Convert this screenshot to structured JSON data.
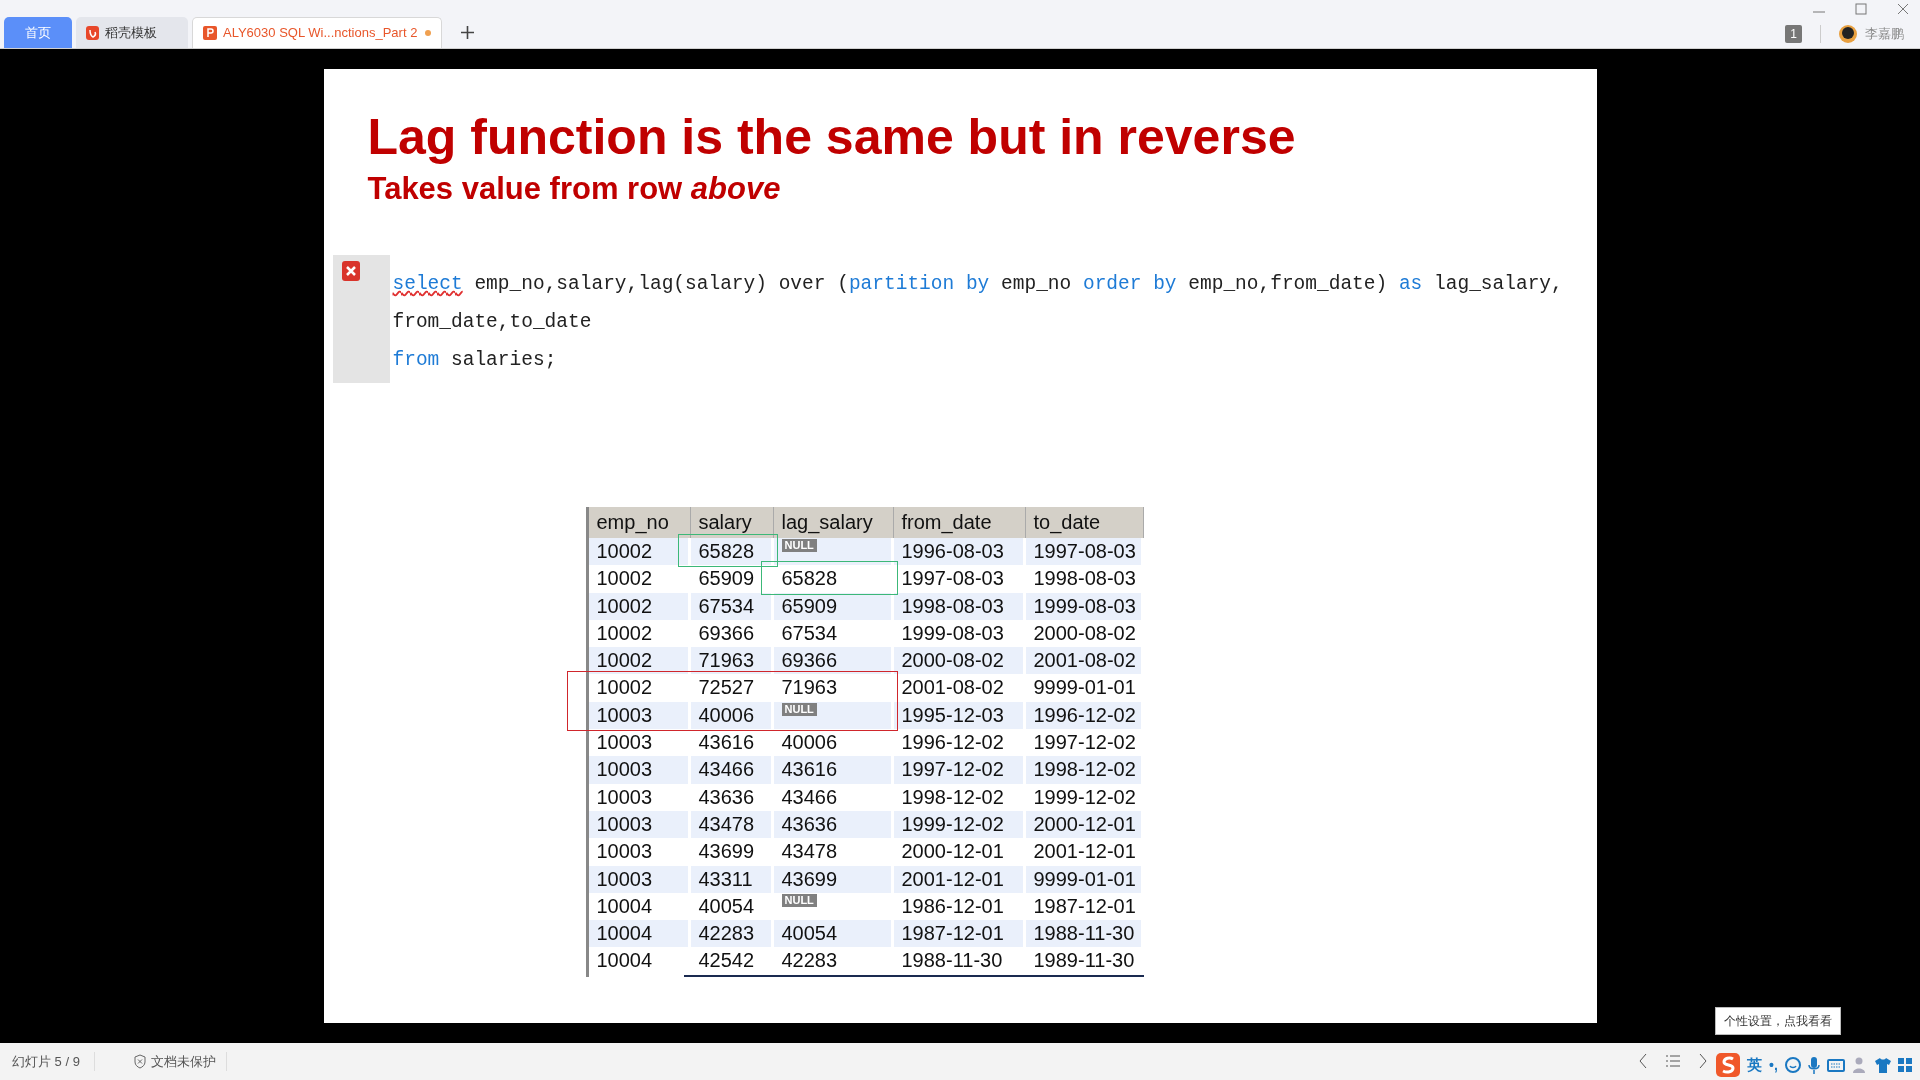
{
  "tabs": [
    {
      "kind": "home",
      "label": "首页",
      "selected": false
    },
    {
      "kind": "templates",
      "label": "稻壳模板",
      "selected": false
    },
    {
      "kind": "document",
      "label": "ALY6030 SQL Wi...nctions_Part 2",
      "selected": true,
      "unsaved": true
    }
  ],
  "account": {
    "badge": "1",
    "user": "李嘉鹏"
  },
  "slide": {
    "title": "Lag function is the same but in reverse",
    "subtitle": "Takes value from row *above*",
    "code": [
      [
        {
          "text": "select",
          "kind": "keyword",
          "error": true
        },
        {
          "text": " emp_no,salary,lag(salary) over (",
          "kind": "plain",
          "error": false
        },
        {
          "text": "partition by",
          "kind": "keyword",
          "error": false
        },
        {
          "text": " emp_no ",
          "kind": "plain",
          "error": false
        },
        {
          "text": "order by",
          "kind": "keyword",
          "error": false
        },
        {
          "text": " emp_no,from_date) ",
          "kind": "plain",
          "error": false
        },
        {
          "text": "as",
          "kind": "keyword",
          "error": false
        },
        {
          "text": " lag_salary,",
          "kind": "plain",
          "error": false
        }
      ],
      [
        {
          "text": "from_date,to_date",
          "kind": "plain",
          "error": false
        }
      ],
      [
        {
          "text": "from",
          "kind": "keyword",
          "error": false
        },
        {
          "text": " salaries;",
          "kind": "plain",
          "error": false
        }
      ]
    ],
    "table": {
      "columns": [
        "emp_no",
        "salary",
        "lag_salary",
        "from_date",
        "to_date"
      ],
      "rows": [
        {
          "cells": [
            "10002",
            "65828",
            "NULL",
            "1996-08-03",
            "1997-08-03"
          ],
          "lag_null": true,
          "cell_frame": {
            "kind": "value",
            "color": "#3cb878"
          }
        },
        {
          "cells": [
            "10002",
            "65909",
            "65828",
            "1997-08-03",
            "1998-08-03"
          ],
          "lag_null": false,
          "cell_frame": {
            "kind": "lag",
            "color": "#3cb878"
          }
        },
        {
          "cells": [
            "10002",
            "67534",
            "65909",
            "1998-08-03",
            "1999-08-03"
          ],
          "lag_null": false
        },
        {
          "cells": [
            "10002",
            "69366",
            "67534",
            "1999-08-03",
            "2000-08-02"
          ],
          "lag_null": false
        },
        {
          "cells": [
            "10002",
            "71963",
            "69366",
            "2000-08-02",
            "2001-08-02"
          ],
          "lag_null": false
        },
        {
          "cells": [
            "10002",
            "72527",
            "71963",
            "2001-08-02",
            "9999-01-01"
          ],
          "lag_null": false,
          "row_frame": {
            "color": "#d0262c"
          }
        },
        {
          "cells": [
            "10003",
            "40006",
            "NULL",
            "1995-12-03",
            "1996-12-02"
          ],
          "lag_null": true,
          "row_frame": {
            "color": "#d0262c"
          }
        },
        {
          "cells": [
            "10003",
            "43616",
            "40006",
            "1996-12-02",
            "1997-12-02"
          ],
          "lag_null": false
        },
        {
          "cells": [
            "10003",
            "43466",
            "43616",
            "1997-12-02",
            "1998-12-02"
          ],
          "lag_null": false
        },
        {
          "cells": [
            "10003",
            "43636",
            "43466",
            "1998-12-02",
            "1999-12-02"
          ],
          "lag_null": false
        },
        {
          "cells": [
            "10003",
            "43478",
            "43636",
            "1999-12-02",
            "2000-12-01"
          ],
          "lag_null": false
        },
        {
          "cells": [
            "10003",
            "43699",
            "43478",
            "2000-12-01",
            "2001-12-01"
          ],
          "lag_null": false
        },
        {
          "cells": [
            "10003",
            "43311",
            "43699",
            "2001-12-01",
            "9999-01-01"
          ],
          "lag_null": false
        },
        {
          "cells": [
            "10004",
            "40054",
            "NULL",
            "1986-12-01",
            "1987-12-01"
          ],
          "lag_null": true
        },
        {
          "cells": [
            "10004",
            "42283",
            "40054",
            "1987-12-01",
            "1988-11-30"
          ],
          "lag_null": false
        },
        {
          "cells": [
            "10004",
            "42542",
            "42283",
            "1988-11-30",
            "1989-11-30"
          ],
          "lag_null": false
        }
      ]
    }
  },
  "status_bar": {
    "slide_counter": "幻灯片 5 / 9",
    "protection": "文档未保护"
  },
  "ime": {
    "tooltip": "个性设置，点我看看",
    "mode": "英",
    "punctuation": "•,"
  }
}
